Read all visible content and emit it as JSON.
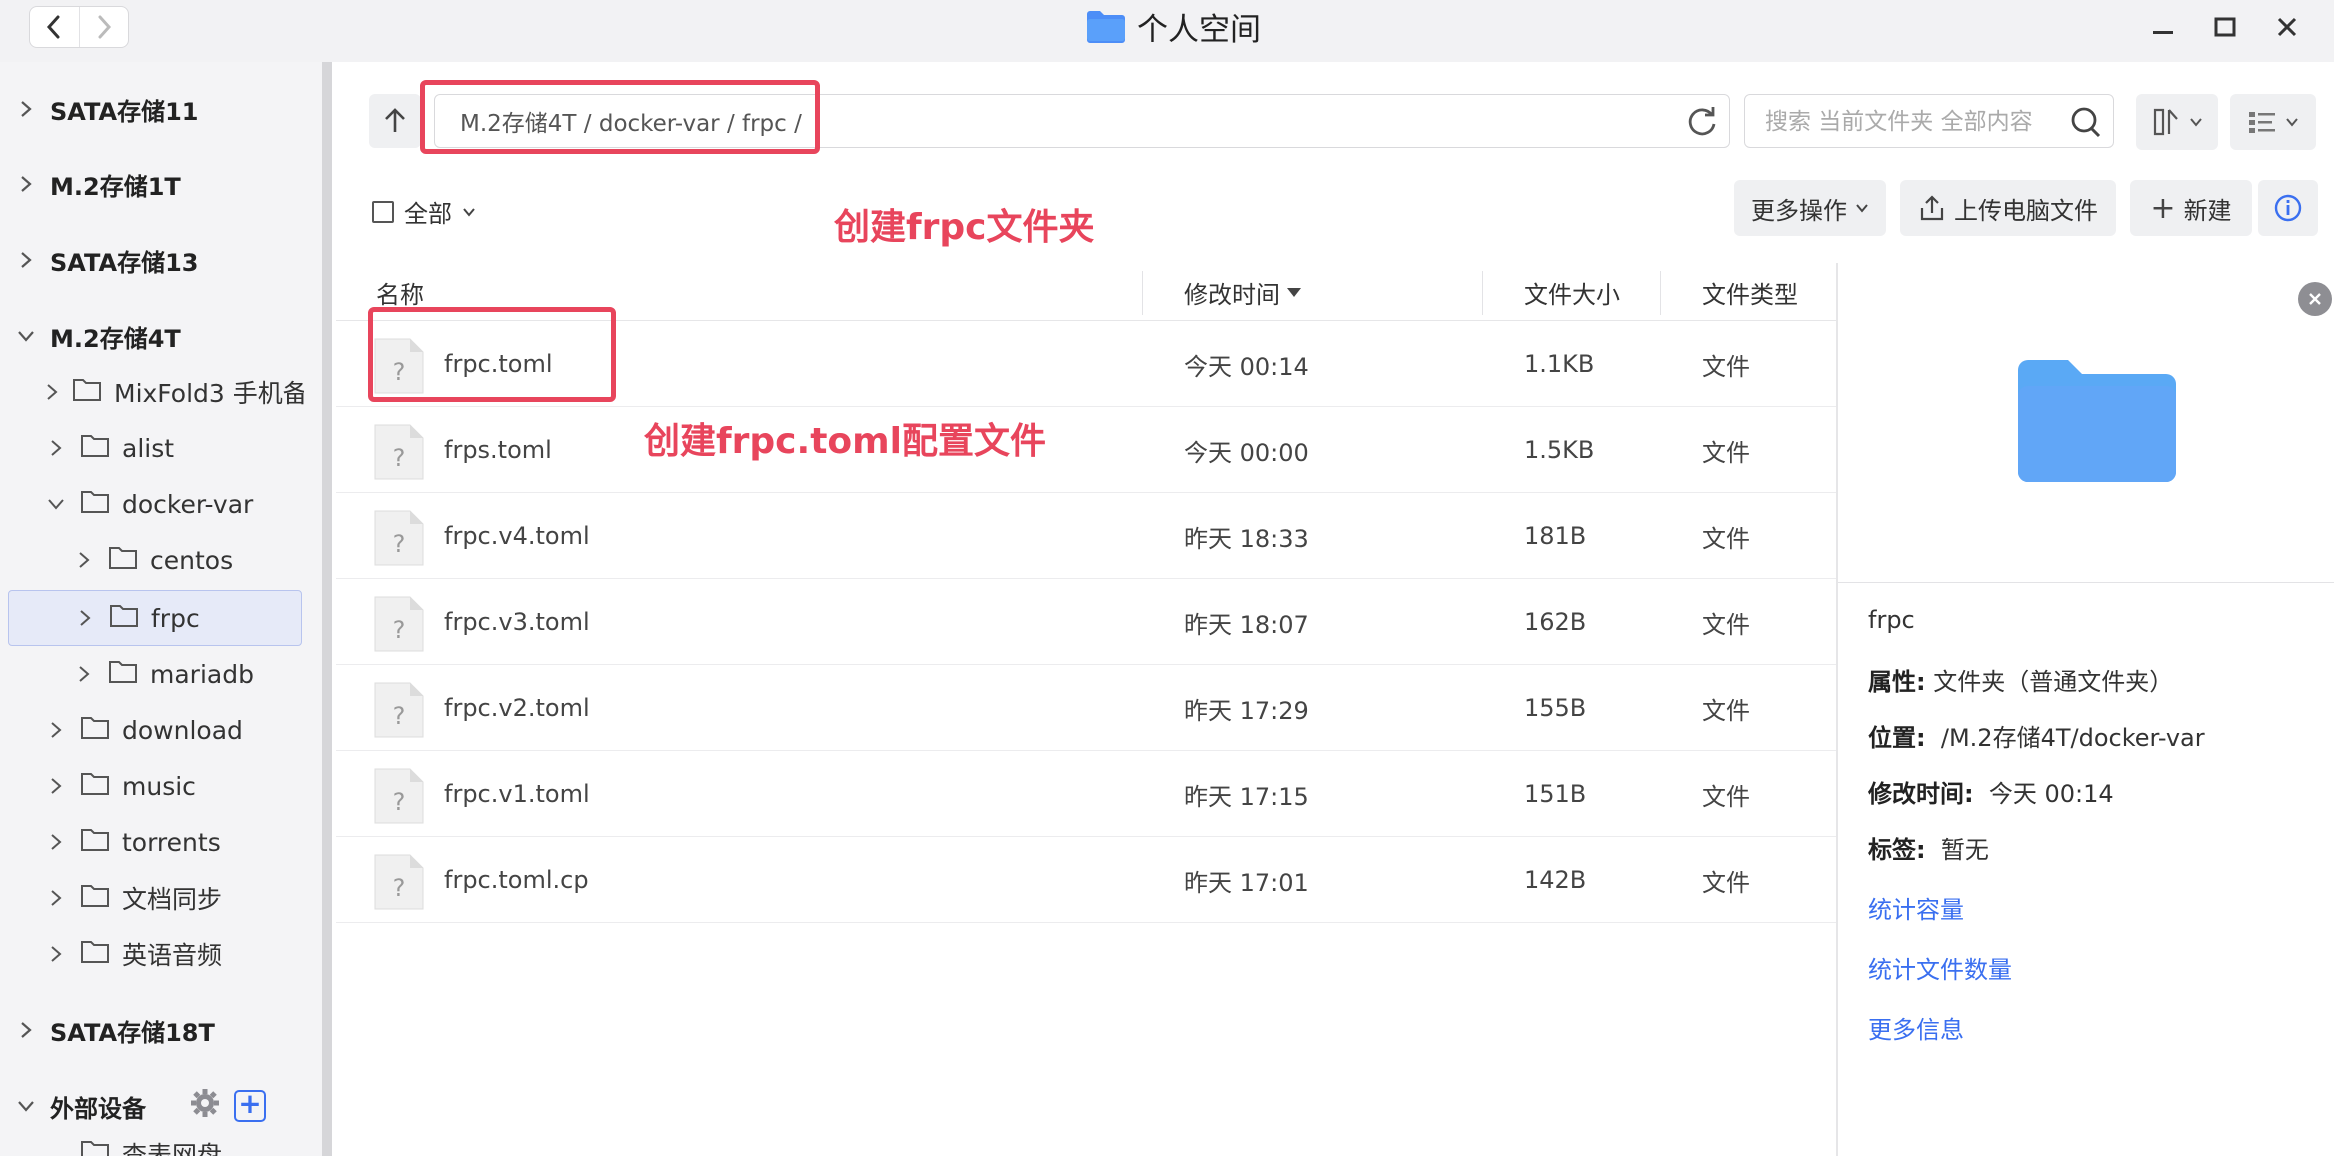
{
  "window": {
    "title": "个人空间"
  },
  "sidebar": {
    "drives": [
      {
        "label": "SATA存储11"
      },
      {
        "label": "M.2存储1T"
      },
      {
        "label": "SATA存储13"
      },
      {
        "label": "M.2存储4T"
      }
    ],
    "folders": [
      {
        "label": "MixFold3 手机备"
      },
      {
        "label": "alist"
      },
      {
        "label": "docker-var"
      },
      {
        "label": "centos"
      },
      {
        "label": "frpc"
      },
      {
        "label": "mariadb"
      },
      {
        "label": "download"
      },
      {
        "label": "music"
      },
      {
        "label": "torrents"
      },
      {
        "label": "文档同步"
      },
      {
        "label": "英语音频"
      }
    ],
    "drive_last": "SATA存储18T",
    "external": "外部设备",
    "partial": "查表网盘"
  },
  "toolbar": {
    "path": "M.2存储4T / docker-var / frpc /",
    "search_placeholder": "搜索 当前文件夹 全部内容",
    "select_all": "全部",
    "more_ops": "更多操作",
    "upload": "上传电脑文件",
    "new": "新建"
  },
  "annotations": {
    "folder_note": "创建frpc文件夹",
    "file_note": "创建frpc.toml配置文件"
  },
  "table": {
    "headers": {
      "name": "名称",
      "modified": "修改时间",
      "size": "文件大小",
      "type": "文件类型"
    },
    "rows": [
      {
        "name": "frpc.toml",
        "modified": "今天 00:14",
        "size": "1.1KB",
        "type": "文件"
      },
      {
        "name": "frps.toml",
        "modified": "今天 00:00",
        "size": "1.5KB",
        "type": "文件"
      },
      {
        "name": "frpc.v4.toml",
        "modified": "昨天 18:33",
        "size": "181B",
        "type": "文件"
      },
      {
        "name": "frpc.v3.toml",
        "modified": "昨天 18:07",
        "size": "162B",
        "type": "文件"
      },
      {
        "name": "frpc.v2.toml",
        "modified": "昨天 17:29",
        "size": "155B",
        "type": "文件"
      },
      {
        "name": "frpc.v1.toml",
        "modified": "昨天 17:15",
        "size": "151B",
        "type": "文件"
      },
      {
        "name": "frpc.toml.cp",
        "modified": "昨天 17:01",
        "size": "142B",
        "type": "文件"
      }
    ]
  },
  "detail": {
    "name": "frpc",
    "attr_label": "属性:",
    "attr_value": "文件夹（普通文件夹）",
    "loc_label": "位置:",
    "loc_value": "/M.2存储4T/docker-var",
    "mtime_label": "修改时间:",
    "mtime_value": "今天 00:14",
    "tag_label": "标签:",
    "tag_value": "暂无",
    "link_capacity": "统计容量",
    "link_count": "统计文件数量",
    "link_more": "更多信息"
  },
  "colors": {
    "accent": "#3a6ff0",
    "annotation": "#e8455c",
    "folder": "#5aa9f5"
  }
}
